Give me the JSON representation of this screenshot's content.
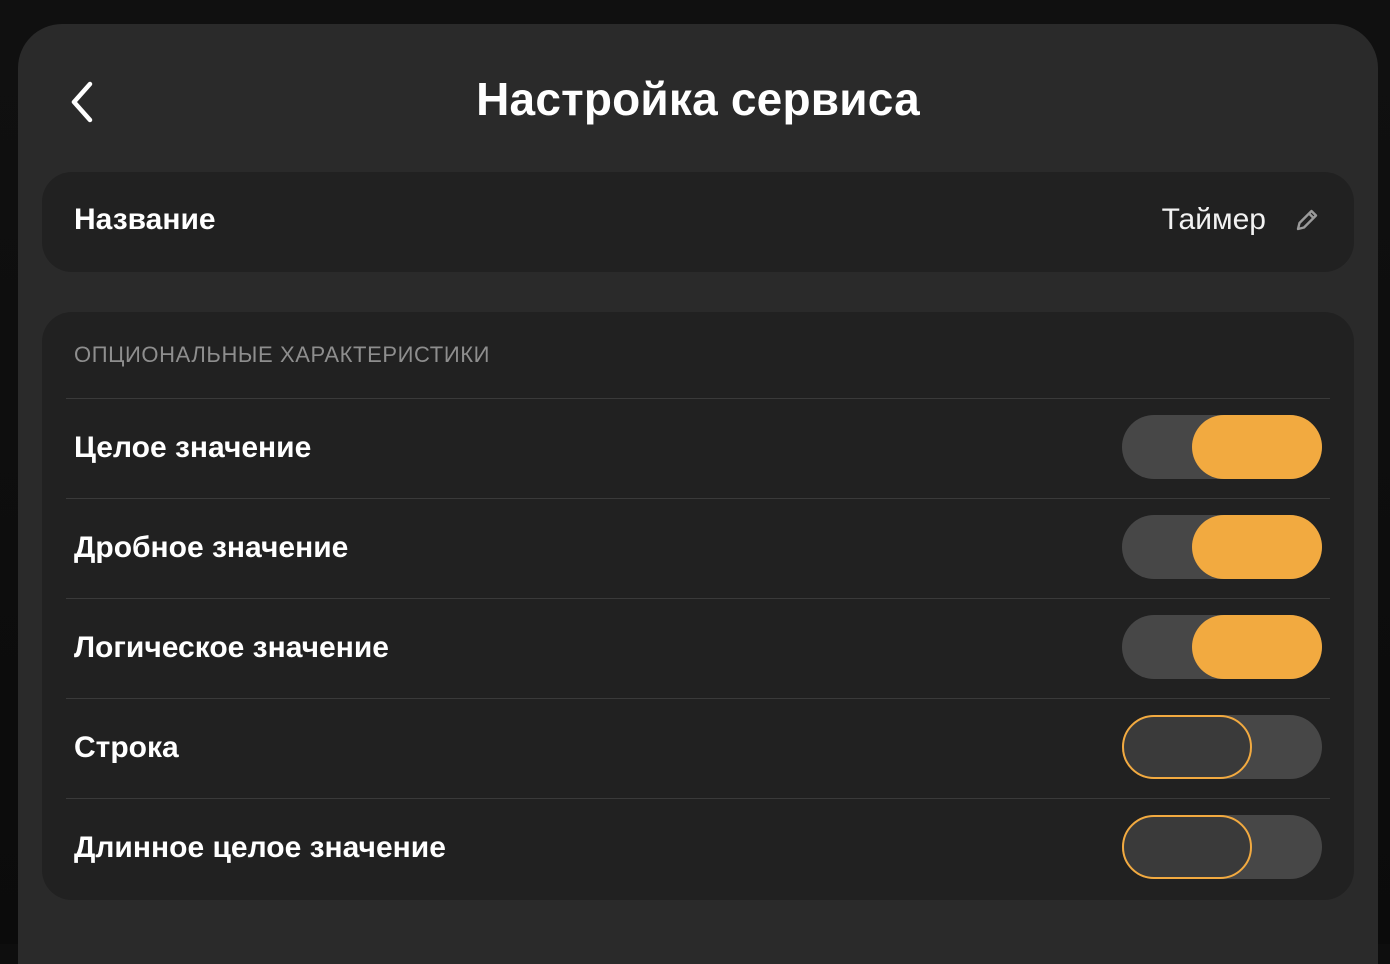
{
  "header": {
    "title": "Настройка сервиса",
    "back_icon": "chevron-left-icon"
  },
  "name_card": {
    "label": "Название",
    "value": "Таймер",
    "edit_icon": "pencil-icon"
  },
  "options": {
    "section_title": "ОПЦИОНАЛЬНЫЕ ХАРАКТЕРИСТИКИ",
    "items": [
      {
        "label": "Целое значение",
        "enabled": true
      },
      {
        "label": "Дробное значение",
        "enabled": true
      },
      {
        "label": "Логическое значение",
        "enabled": true
      },
      {
        "label": "Строка",
        "enabled": false
      },
      {
        "label": "Длинное целое значение",
        "enabled": false
      }
    ]
  },
  "colors": {
    "accent": "#f2aa40",
    "panel": "#2a2a2a",
    "card": "#212121",
    "track": "#474747"
  }
}
